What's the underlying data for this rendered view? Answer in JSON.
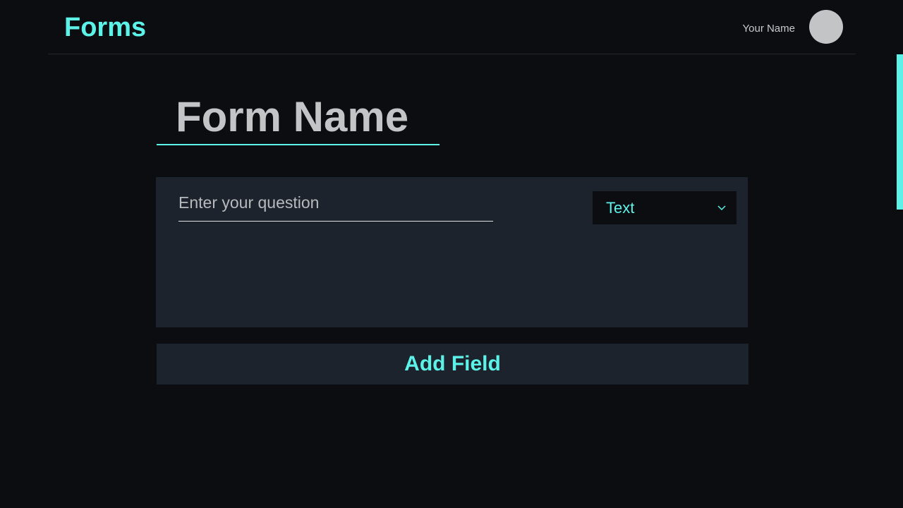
{
  "header": {
    "app_title": "Forms",
    "user_name": "Your Name"
  },
  "form": {
    "name_placeholder": "Form Name",
    "question": {
      "placeholder": "Enter your question",
      "value": "",
      "type_selected": "Text"
    },
    "add_field_label": "Add Field"
  },
  "colors": {
    "accent": "#5df2e7",
    "background": "#0b0d11",
    "card": "#1c232c",
    "text_muted": "#c3c4c6"
  },
  "icons": {
    "type_dropdown": "chevron-down-icon",
    "avatar": "avatar"
  }
}
